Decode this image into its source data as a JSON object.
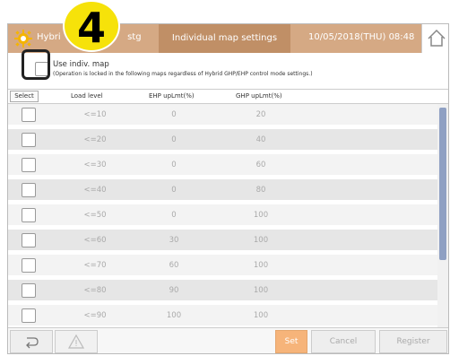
{
  "header": {
    "title_left_pre": "Hybri",
    "title_left_post": "stg",
    "title_center": "Individual map settings",
    "datetime": "10/05/2018(THU) 08:48"
  },
  "options": {
    "use_indiv_label": "Use indiv. map",
    "note": "(Operation is locked in the following maps regardless of Hybrid GHP/EHP control mode settings.)"
  },
  "columns": {
    "select": "Select",
    "load": "Load level",
    "ehp": "EHP upLmt(%)",
    "ghp": "GHP upLmt(%)"
  },
  "table": [
    {
      "load": "<=10",
      "ehp": "0",
      "ghp": "20"
    },
    {
      "load": "<=20",
      "ehp": "0",
      "ghp": "40"
    },
    {
      "load": "<=30",
      "ehp": "0",
      "ghp": "60"
    },
    {
      "load": "<=40",
      "ehp": "0",
      "ghp": "80"
    },
    {
      "load": "<=50",
      "ehp": "0",
      "ghp": "100"
    },
    {
      "load": "<=60",
      "ehp": "30",
      "ghp": "100"
    },
    {
      "load": "<=70",
      "ehp": "60",
      "ghp": "100"
    },
    {
      "load": "<=80",
      "ehp": "90",
      "ghp": "100"
    },
    {
      "load": "<=90",
      "ehp": "100",
      "ghp": "100"
    }
  ],
  "footer": {
    "set": "Set",
    "cancel": "Cancel",
    "register": "Register"
  },
  "annotation": {
    "badge": "4"
  },
  "colors": {
    "accent": "#d5a984",
    "set_button": "#f6b47a",
    "badge": "#f6e20a"
  }
}
